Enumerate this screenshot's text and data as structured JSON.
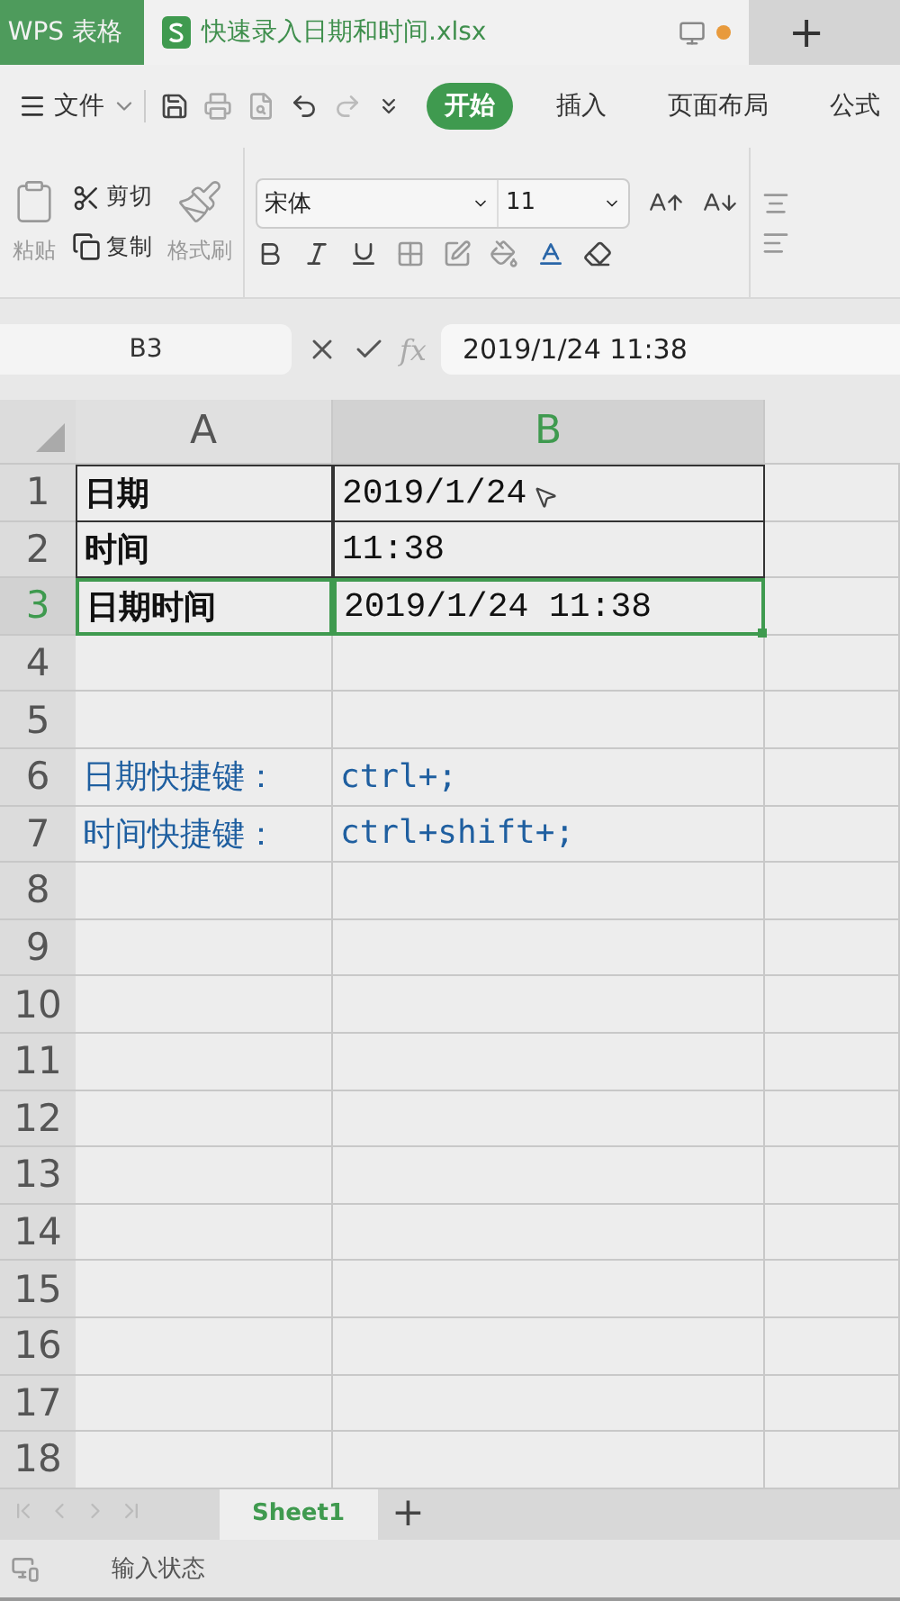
{
  "title_bar": {
    "app_tab": "WPS 表格",
    "file_tab": {
      "label": "快速录入日期和时间.xlsx",
      "modified": true
    },
    "new_tab": "+"
  },
  "menu_bar": {
    "file_menu": "文件",
    "tabs": [
      {
        "label": "开始",
        "selected": true
      },
      {
        "label": "插入",
        "selected": false
      },
      {
        "label": "页面布局",
        "selected": false
      },
      {
        "label": "公式",
        "selected": false
      }
    ]
  },
  "ribbon": {
    "paste": "粘贴",
    "cut": "剪切",
    "copy": "复制",
    "format_painter": "格式刷",
    "font": "宋体",
    "font_size": "11"
  },
  "formula_bar": {
    "cell_ref": "B3",
    "fx": "fx",
    "value": "2019/1/24 11:38"
  },
  "sheet": {
    "columns": [
      {
        "label": "A",
        "selected": false
      },
      {
        "label": "B",
        "selected": true
      }
    ],
    "rows": [
      {
        "number": "1",
        "selected": false,
        "cells": [
          {
            "text": "日期",
            "kind": "label",
            "boxed": true,
            "selected": false
          },
          {
            "text": "2019/1/24",
            "kind": "value",
            "boxed": true,
            "selected": false
          }
        ]
      },
      {
        "number": "2",
        "selected": false,
        "cells": [
          {
            "text": "时间",
            "kind": "label",
            "boxed": true,
            "selected": false
          },
          {
            "text": "11:38",
            "kind": "value",
            "boxed": true,
            "selected": false
          }
        ]
      },
      {
        "number": "3",
        "selected": true,
        "cells": [
          {
            "text": "日期时间",
            "kind": "label",
            "boxed": true,
            "selected": true
          },
          {
            "text": "2019/1/24 11:38",
            "kind": "value",
            "boxed": true,
            "selected": true
          }
        ]
      },
      {
        "number": "4",
        "selected": false
      },
      {
        "number": "5",
        "selected": false
      },
      {
        "number": "6",
        "selected": false,
        "cells": [
          {
            "text": "日期快捷键：",
            "kind": "note",
            "boxed": false,
            "selected": false
          },
          {
            "text": "ctrl+;",
            "kind": "note",
            "boxed": false,
            "selected": false
          }
        ]
      },
      {
        "number": "7",
        "selected": false,
        "cells": [
          {
            "text": "时间快捷键：",
            "kind": "note",
            "boxed": false,
            "selected": false
          },
          {
            "text": "ctrl+shift+;",
            "kind": "note",
            "boxed": false,
            "selected": false
          }
        ]
      },
      {
        "number": "8",
        "selected": false
      },
      {
        "number": "9",
        "selected": false
      },
      {
        "number": "10",
        "selected": false
      },
      {
        "number": "11",
        "selected": false
      },
      {
        "number": "12",
        "selected": false
      },
      {
        "number": "13",
        "selected": false
      },
      {
        "number": "14",
        "selected": false
      },
      {
        "number": "15",
        "selected": false
      },
      {
        "number": "16",
        "selected": false
      },
      {
        "number": "17",
        "selected": false
      },
      {
        "number": "18",
        "selected": false
      }
    ]
  },
  "sheet_tabs": {
    "tabs": [
      {
        "label": "Sheet1",
        "selected": true
      }
    ],
    "add": "+"
  },
  "status_bar": {
    "mode": "输入状态"
  }
}
